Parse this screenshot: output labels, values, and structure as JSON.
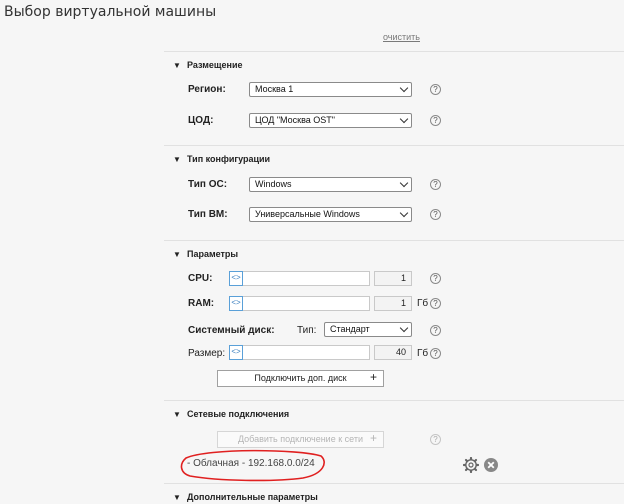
{
  "page": {
    "title": "Выбор виртуальной машины",
    "clear_link": "очистить"
  },
  "placement": {
    "title": "Размещение",
    "region": {
      "label": "Регион:",
      "value": "Москва 1"
    },
    "dc": {
      "label": "ЦОД:",
      "value": "ЦОД \"Москва OST\""
    }
  },
  "config": {
    "title": "Тип конфигурации",
    "os": {
      "label": "Тип ОС:",
      "value": "Windows"
    },
    "vm": {
      "label": "Тип ВМ:",
      "value": "Универсальные Windows"
    }
  },
  "params": {
    "title": "Параметры",
    "cpu": {
      "label": "CPU:",
      "value": "1"
    },
    "ram": {
      "label": "RAM:",
      "value": "1",
      "unit": "Гб"
    },
    "disk": {
      "label": "Системный диск:",
      "type_label": "Тип:",
      "type_value": "Стандарт",
      "size_label": "Размер:",
      "size_value": "40",
      "unit": "Гб"
    },
    "add_disk_button": "Подключить доп. диск"
  },
  "network": {
    "title": "Сетевые подключения",
    "add_button": "Добавить подключение к сети",
    "item": "- Облачная - 192.168.0.0/24"
  },
  "extra": {
    "title": "Дополнительные параметры"
  },
  "icons": {
    "help": "?",
    "plus": "+",
    "slider_handle": "<>",
    "section_toggle": "▼"
  },
  "colors": {
    "highlight_ring": "#e02020",
    "slider_accent": "#5aa0d8"
  }
}
